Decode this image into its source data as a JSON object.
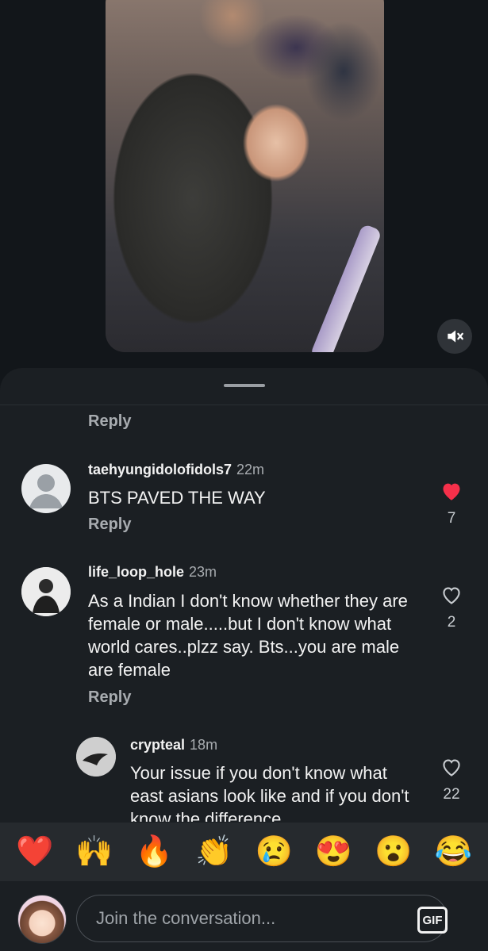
{
  "video": {
    "mute_icon": "speaker-muted-icon"
  },
  "comments": [
    {
      "reply_label": "Reply"
    },
    {
      "username": "taehyungidolofidols7",
      "time": "22m",
      "text": "BTS PAVED THE WAY",
      "reply_label": "Reply",
      "likes": "7",
      "liked": true
    },
    {
      "username": "life_loop_hole",
      "time": "23m",
      "text": "As a Indian I don't know whether they are female or male.....but I don't know what world cares..plzz say. Bts...you are male are female",
      "reply_label": "Reply",
      "likes": "2",
      "liked": false
    },
    {
      "username": "crypteal",
      "time": "18m",
      "text": "Your issue if you don't know what east asians look like and if you don't know the difference",
      "likes": "22",
      "liked": false
    }
  ],
  "emoji_bar": [
    "❤️",
    "🙌",
    "🔥",
    "👏",
    "😢",
    "😍",
    "😮",
    "😂"
  ],
  "composer": {
    "placeholder": "Join the conversation...",
    "gif_label": "GIF"
  },
  "colors": {
    "liked_heart": "#f5304a",
    "sheet_bg": "#1b1f23",
    "emoji_bar_bg": "#262a2e"
  }
}
